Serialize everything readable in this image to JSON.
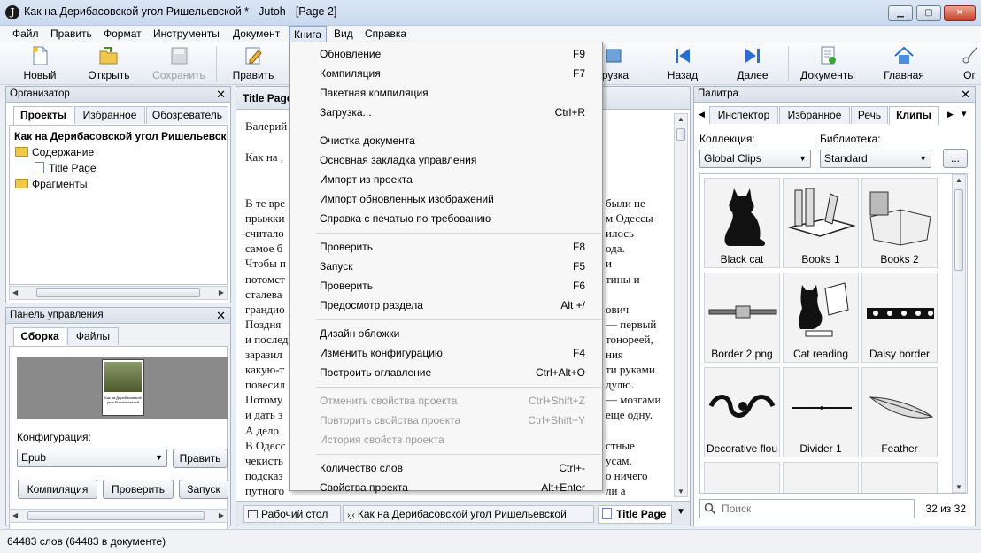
{
  "window": {
    "title": "Как на Дерибасовской угол Ришельевской * - Jutoh - [Page 2]",
    "app_icon_glyph": "J",
    "min_glyph": "▁",
    "max_glyph": "▢",
    "close_glyph": "✕"
  },
  "menubar": [
    "Файл",
    "Править",
    "Формат",
    "Инструменты",
    "Документ",
    "Книга",
    "Вид",
    "Справка"
  ],
  "toolbar": {
    "new": "Новый",
    "open": "Открыть",
    "save": "Сохранить",
    "edit": "Править",
    "upload_partial": "рузка",
    "back": "Назад",
    "forward": "Далее",
    "documents": "Документы",
    "home": "Главная",
    "cut_partial": "Ог"
  },
  "organizer": {
    "title": "Организатор",
    "tabs": [
      "Проекты",
      "Избранное",
      "Обозреватель"
    ],
    "tree": {
      "root": "Как на Дерибасовской угол Ришельевской",
      "contents": "Содержание",
      "title_page": "Title Page",
      "fragments": "Фрагменты"
    }
  },
  "control_panel": {
    "title": "Панель управления",
    "tabs": [
      "Сборка",
      "Файлы"
    ],
    "cover_caption": "Как на Дерибасовской угол Ришельевской",
    "config_label": "Конфигурация:",
    "config_value": "Epub",
    "edit_button": "Править",
    "compile_button": "Компиляция",
    "check_button": "Проверить",
    "run_button": "Запуск"
  },
  "editor": {
    "tab_title": "Title Page",
    "lines_left": [
      "Валерий",
      "Как на ,",
      "",
      "В те вре",
      "прыжки",
      "считало",
      "самое б",
      "Чтобы п",
      "потомст",
      "сталева",
      "грандио",
      "Поздня",
      "и послед",
      "заразил",
      "какую-т",
      "повесил",
      "Потому",
      "и дать з",
      "А дело",
      "В Одесс",
      "чекисть",
      "подсказ",
      "путного"
    ],
    "lines_right": [
      "были не",
      "м Одессы",
      "илось",
      "ода.",
      "и",
      "тины и",
      "",
      "ович",
      "— первый",
      "тонореей,",
      "ния",
      "ти руками",
      "дулю.",
      "— мозгами",
      "еще одну.",
      "",
      "стные",
      "усам,",
      "о ничего",
      "ли а"
    ],
    "bottom_tabs": [
      "Рабочий стол",
      "Как на Дерибасовской угол Ришельевской",
      "Title Page"
    ]
  },
  "palette": {
    "title": "Палитра",
    "tabs": [
      "Инспектор",
      "Избранное",
      "Речь",
      "Клипы"
    ],
    "collection_label": "Коллекция:",
    "collection_value": "Global Clips",
    "library_label": "Библиотека:",
    "library_value": "Standard",
    "more_button": "...",
    "clips": [
      "Black cat",
      "Books 1",
      "Books 2",
      "Border 2.png",
      "Cat reading",
      "Daisy border",
      "Decorative flou",
      "Divider 1",
      "Feather"
    ],
    "search_placeholder": "Поиск",
    "count": "32 из 32"
  },
  "book_menu": {
    "groups": [
      [
        {
          "label": "Обновление",
          "shortcut": "F9",
          "enabled": true
        },
        {
          "label": "Компиляция",
          "shortcut": "F7",
          "enabled": true
        },
        {
          "label": "Пакетная компиляция",
          "shortcut": "",
          "enabled": true
        },
        {
          "label": "Загрузка...",
          "shortcut": "Ctrl+R",
          "enabled": true
        }
      ],
      [
        {
          "label": "Очистка документа",
          "shortcut": "",
          "enabled": true
        },
        {
          "label": "Основная закладка управления",
          "shortcut": "",
          "enabled": true
        },
        {
          "label": "Импорт из проекта",
          "shortcut": "",
          "enabled": true
        },
        {
          "label": "Импорт обновленных изображений",
          "shortcut": "",
          "enabled": true
        },
        {
          "label": "Справка с печатью по требованию",
          "shortcut": "",
          "enabled": true
        }
      ],
      [
        {
          "label": "Проверить",
          "shortcut": "F8",
          "enabled": true
        },
        {
          "label": "Запуск",
          "shortcut": "F5",
          "enabled": true
        },
        {
          "label": "Проверить",
          "shortcut": "F6",
          "enabled": true
        },
        {
          "label": "Предосмотр раздела",
          "shortcut": "Alt +/",
          "enabled": true
        }
      ],
      [
        {
          "label": "Дизайн обложки",
          "shortcut": "",
          "enabled": true
        },
        {
          "label": "Изменить конфигурацию",
          "shortcut": "F4",
          "enabled": true
        },
        {
          "label": "Построить оглавление",
          "shortcut": "Ctrl+Alt+O",
          "enabled": true
        }
      ],
      [
        {
          "label": "Отменить свойства проекта",
          "shortcut": "Ctrl+Shift+Z",
          "enabled": false
        },
        {
          "label": "Повторить свойства проекта",
          "shortcut": "Ctrl+Shift+Y",
          "enabled": false
        },
        {
          "label": "История свойств проекта",
          "shortcut": "",
          "enabled": false
        }
      ],
      [
        {
          "label": "Количество слов",
          "shortcut": "Ctrl+-",
          "enabled": true
        },
        {
          "label": "Свойства проекта",
          "shortcut": "Alt+Enter",
          "enabled": true
        }
      ]
    ]
  },
  "status": "64483 слов (64483 в документе)"
}
